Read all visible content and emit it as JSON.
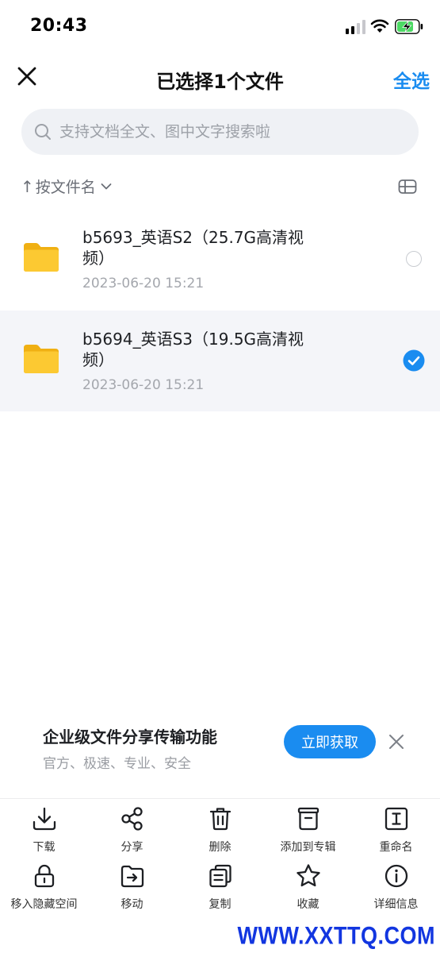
{
  "status_bar": {
    "time": "20:43"
  },
  "nav": {
    "title": "已选择1个文件",
    "select_all": "全选"
  },
  "search": {
    "placeholder": "支持文档全文、图中文字搜索啦"
  },
  "sort": {
    "label": "按文件名"
  },
  "files": [
    {
      "name": "b5693_英语S2（25.7G高清视频）",
      "date": "2023-06-20 15:21",
      "selected": false
    },
    {
      "name": "b5694_英语S3（19.5G高清视频）",
      "date": "2023-06-20 15:21",
      "selected": true
    }
  ],
  "promo": {
    "title": "企业级文件分享传输功能",
    "subtitle": "官方、极速、专业、安全",
    "button": "立即获取"
  },
  "toolbar": {
    "download": "下载",
    "share": "分享",
    "delete": "删除",
    "add_to_album": "添加到专辑",
    "rename": "重命名",
    "move_to_hidden": "移入隐藏空间",
    "move": "移动",
    "copy": "复制",
    "favorite": "收藏",
    "details": "详细信息"
  },
  "watermark": "WWW.XXTTQ.COM",
  "colors": {
    "accent": "#1a8cf0",
    "folder": "#fbc52d",
    "selected_row": "#f4f5f9"
  }
}
